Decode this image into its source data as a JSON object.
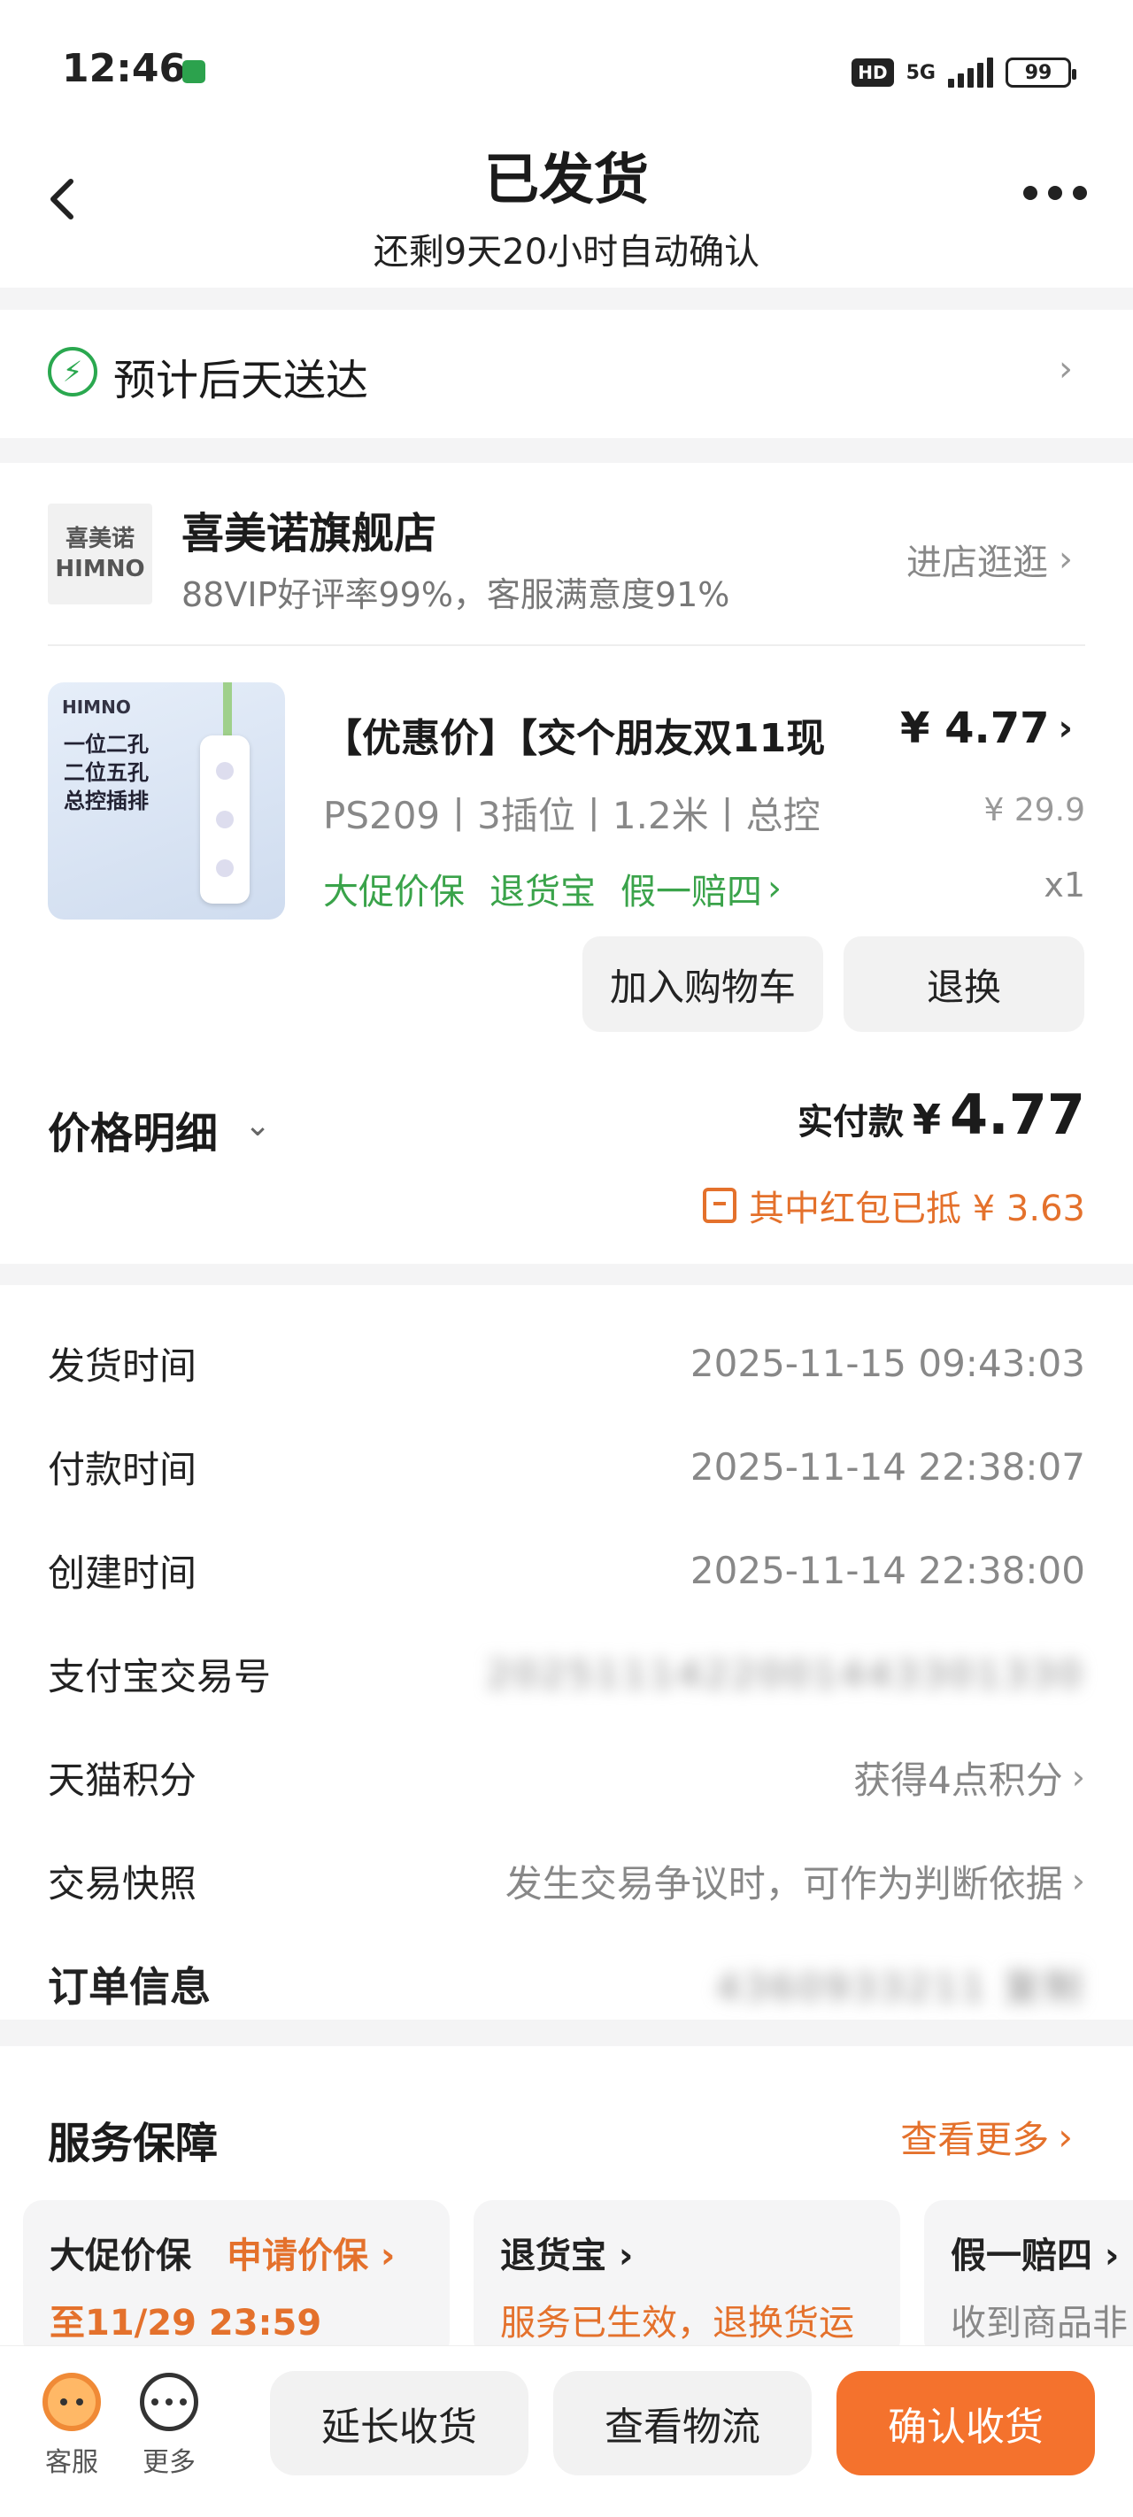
{
  "status_bar": {
    "time": "12:46",
    "hd": "HD",
    "network": "5G",
    "battery": "99"
  },
  "header": {
    "title": "已发货",
    "subtitle": "还剩9天20小时自动确认"
  },
  "delivery": {
    "text": "预计后天送达"
  },
  "shop": {
    "logo_cn": "喜美诺",
    "logo_en": "HIMNO",
    "name": "喜美诺旗舰店",
    "stats": "88VIP好评率99%，客服满意度91%",
    "enter_label": "进店逛逛"
  },
  "product": {
    "image_brand": "HIMNO",
    "image_lines": [
      "一位二孔",
      "二位五孔",
      "总控插排"
    ],
    "title": "【优惠价】【交个朋友双11现",
    "price": "¥ 4.77",
    "spec": "PS209丨3插位丨1.2米丨总控",
    "original_price": "¥ 29.9",
    "tags": [
      "大促价保",
      "退货宝",
      "假一赔四"
    ],
    "quantity": "x1",
    "add_cart_label": "加入购物车",
    "refund_label": "退换"
  },
  "price_detail": {
    "label": "价格明细",
    "paid_label": "实付款",
    "paid_currency": "¥",
    "paid_amount": "4.77",
    "redpacket_text": "其中红包已抵 ¥ 3.63"
  },
  "order_info": {
    "ship_time": {
      "label": "发货时间",
      "value": "2025-11-15 09:43:03"
    },
    "pay_time": {
      "label": "付款时间",
      "value": "2025-11-14 22:38:07"
    },
    "create_time": {
      "label": "创建时间",
      "value": "2025-11-14 22:38:00"
    },
    "alipay_no": {
      "label": "支付宝交易号",
      "value": "2025111422001443301330"
    },
    "tmall_points": {
      "label": "天猫积分",
      "value": "获得4点积分"
    },
    "snapshot": {
      "label": "交易快照",
      "value": "发生交易争议时，可作为判断依据"
    },
    "order_no": {
      "label": "订单信息",
      "value": "4360933211  复制"
    }
  },
  "service": {
    "title": "服务保障",
    "more_label": "查看更多",
    "cards": [
      {
        "title": "大促价保",
        "action": "申请价保",
        "sub": "至11/29 23:59"
      },
      {
        "title": "退货宝",
        "action": "",
        "sub": "服务已生效，退换货运"
      },
      {
        "title": "假一赔四",
        "action": "",
        "sub": "收到商品非"
      }
    ]
  },
  "bottom_bar": {
    "kefu_label": "客服",
    "more_label": "更多",
    "extend_label": "延长收货",
    "logistics_label": "查看物流",
    "confirm_label": "确认收货"
  }
}
